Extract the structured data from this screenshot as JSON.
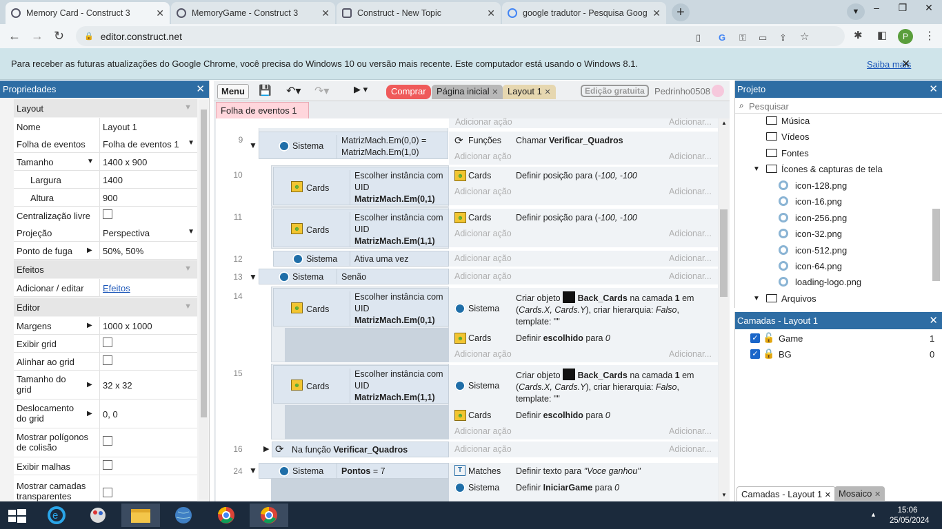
{
  "browser": {
    "tabs": [
      {
        "title": "Memory Card - Construct 3",
        "active": true
      },
      {
        "title": "MemoryGame - Construct 3",
        "active": false
      },
      {
        "title": "Construct - New Topic",
        "active": false
      },
      {
        "title": "google tradutor - Pesquisa Goog",
        "active": false
      }
    ],
    "url": "editor.construct.net",
    "profile_initial": "P",
    "infobar_text": "Para receber as futuras atualizações do Google Chrome, você precisa do Windows 10 ou versão mais recente. Este computador está usando o Windows 8.1.",
    "infobar_link": "Saiba mais"
  },
  "properties": {
    "title": "Propriedades",
    "sections": {
      "layout": "Layout",
      "effects": "Efeitos",
      "editor": "Editor"
    },
    "rows": {
      "nome": {
        "label": "Nome",
        "value": "Layout 1"
      },
      "folha": {
        "label": "Folha de eventos",
        "value": "Folha de eventos 1"
      },
      "tamanho": {
        "label": "Tamanho",
        "value": "1400 x 900"
      },
      "largura": {
        "label": "Largura",
        "value": "1400"
      },
      "altura": {
        "label": "Altura",
        "value": "900"
      },
      "centralizacao": {
        "label": "Centralização livre"
      },
      "projecao": {
        "label": "Projeção",
        "value": "Perspectiva"
      },
      "fuga": {
        "label": "Ponto de fuga",
        "value": "50%, 50%"
      },
      "efeitos": {
        "label": "Adicionar / editar",
        "value": "Efeitos"
      },
      "margens": {
        "label": "Margens",
        "value": "1000 x 1000"
      },
      "exibir_grid": {
        "label": "Exibir grid"
      },
      "alinhar": {
        "label": "Alinhar ao grid"
      },
      "tam_grid": {
        "label": "Tamanho do grid",
        "value": "32 x 32"
      },
      "desloc": {
        "label": "Deslocamento do grid",
        "value": "0, 0"
      },
      "poligonos": {
        "label": "Mostrar polígonos de colisão"
      },
      "malhas": {
        "label": "Exibir malhas"
      },
      "camadas": {
        "label": "Mostrar camadas transparentes"
      }
    }
  },
  "editor": {
    "menu": "Menu",
    "comprar": "Comprar",
    "pagina_inicial": "Página inicial",
    "layout_tab": "Layout 1",
    "gratuita": "Edição gratuita",
    "user": "Pedrinho0508",
    "sheet_tab": "Folha de eventos 1",
    "add_action": "Adicionar ação",
    "add_short": "Adicionar...",
    "events": {
      "e9": {
        "num": "9",
        "obj": "Sistema",
        "cond": "MatrizMach.Em(0,0) = MatrizMach.Em(1,0)",
        "act_obj": "Funções",
        "act": "Chamar ",
        "act_b": "Verificar_Quadros"
      },
      "e10": {
        "num": "10",
        "obj": "Cards",
        "cond": "Escolher instância com UID ",
        "cond_b": "MatrizMach.Em(0,1)",
        "act_obj": "Cards",
        "act": "Definir posição para (",
        "act_i": "-100, -100"
      },
      "e11": {
        "num": "11",
        "obj": "Cards",
        "cond": "Escolher instância com UID ",
        "cond_b": "MatrizMach.Em(1,1)",
        "act_obj": "Cards",
        "act": "Definir posição para (",
        "act_i": "-100, -100"
      },
      "e12": {
        "num": "12",
        "obj": "Sistema",
        "cond": "Ativa uma vez"
      },
      "e13": {
        "num": "13",
        "obj": "Sistema",
        "cond": "Senão"
      },
      "e14": {
        "num": "14",
        "obj": "Cards",
        "cond": "Escolher instância com UID ",
        "cond_b": "MatrizMach.Em(0,1)",
        "a1_obj": "Sistema",
        "a1_1": "Criar objeto ",
        "a1_b": "Back_Cards",
        "a1_2": " na camada ",
        "a1_n": "1",
        "a1_3": " em (",
        "a1_i1": "Cards.X, Cards.Y",
        "a1_4": "), criar hierarquia: ",
        "a1_i2": "Falso",
        "a1_5": ", template: \"\"",
        "a2_obj": "Cards",
        "a2_1": "Definir ",
        "a2_b": "escolhido",
        "a2_2": " para ",
        "a2_i": "0"
      },
      "e15": {
        "num": "15",
        "obj": "Cards",
        "cond": "Escolher instância com UID ",
        "cond_b": "MatrizMach.Em(1,1)",
        "a1_obj": "Sistema",
        "a2_obj": "Cards"
      },
      "e16": {
        "num": "16",
        "pre": "Na função ",
        "name": "Verificar_Quadros"
      },
      "e24": {
        "num": "24",
        "obj": "Sistema",
        "cond_b": "Pontos",
        "cond": " = 7",
        "a1_obj": "Matches",
        "a1": "Definir texto para ",
        "a1_i": "\"Voce ganhou\"",
        "a2_obj": "Sistema",
        "a2": "Definir ",
        "a2_b": "IniciarGame",
        "a2_2": " para ",
        "a2_i": "0"
      }
    }
  },
  "project": {
    "title": "Projeto",
    "search_placeholder": "Pesquisar",
    "folders": [
      "Música",
      "Vídeos",
      "Fontes",
      "Ícones & capturas de tela",
      "Arquivos"
    ],
    "files": [
      "icon-128.png",
      "icon-16.png",
      "icon-256.png",
      "icon-32.png",
      "icon-512.png",
      "icon-64.png",
      "loading-logo.png"
    ]
  },
  "layers": {
    "title": "Camadas - Layout 1",
    "items": [
      {
        "name": "Game",
        "index": "1"
      },
      {
        "name": "BG",
        "index": "0"
      }
    ],
    "bottom_tabs": [
      "Camadas - Layout 1",
      "Mosaico"
    ]
  },
  "taskbar": {
    "time": "15:06",
    "date": "25/05/2024"
  }
}
